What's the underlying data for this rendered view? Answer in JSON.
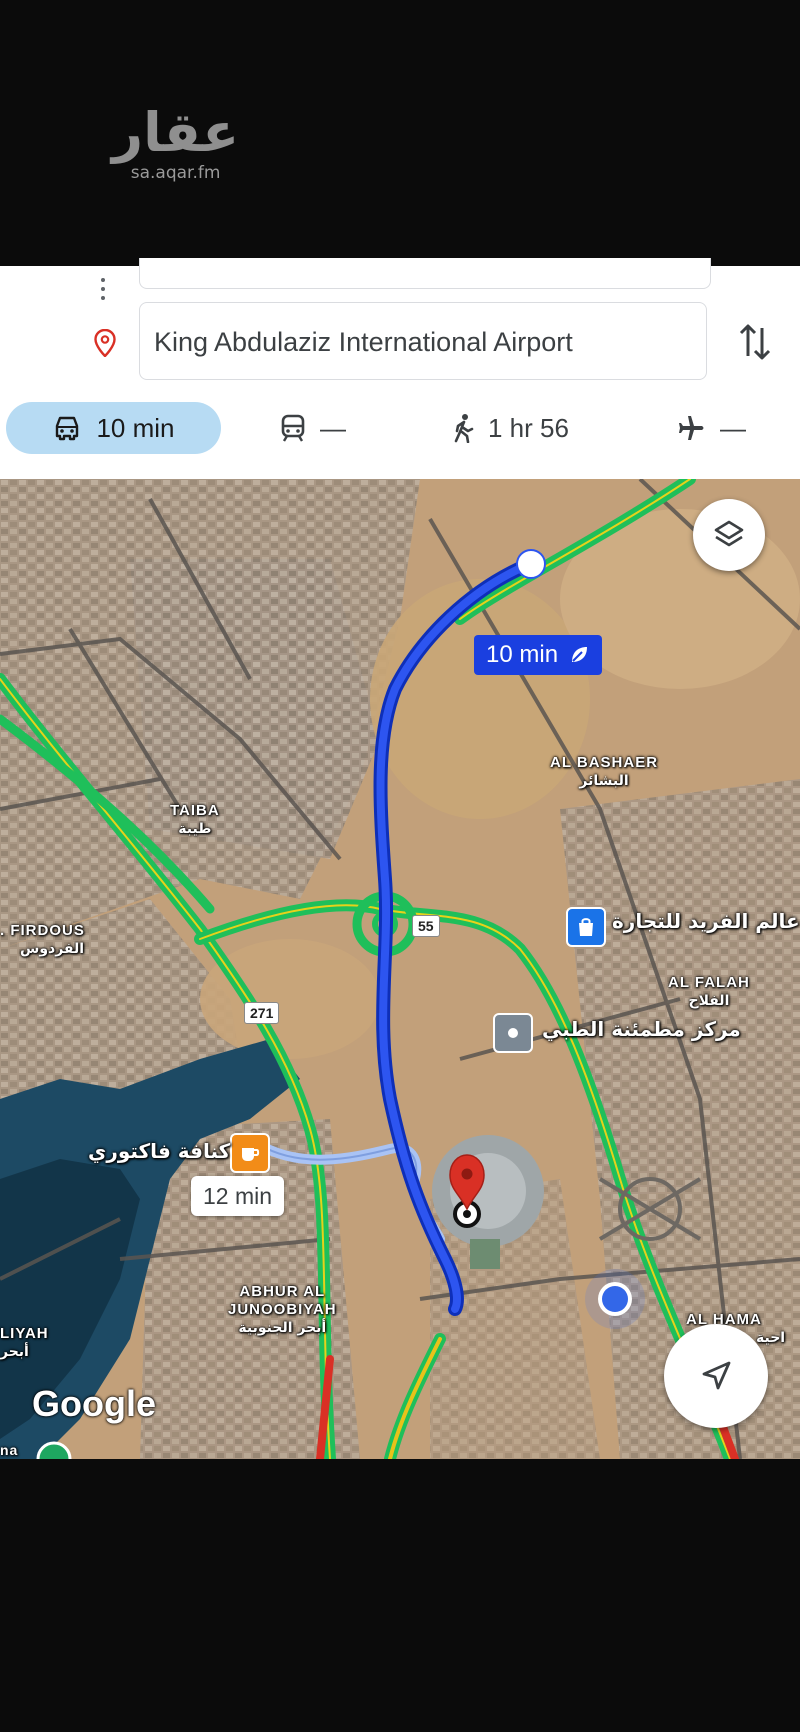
{
  "watermark": {
    "brand": "عقار",
    "url": "sa.aqar.fm"
  },
  "directions": {
    "destination": "King Abdulaziz International Airport",
    "modes": [
      {
        "name": "drive",
        "icon": "car-icon",
        "label": "10 min",
        "selected": true
      },
      {
        "name": "transit",
        "icon": "train-icon",
        "label": "—"
      },
      {
        "name": "walk",
        "icon": "walk-icon",
        "label": "1 hr 56"
      },
      {
        "name": "flight",
        "icon": "plane-icon",
        "label": "—"
      }
    ]
  },
  "map": {
    "route_badge": "10 min",
    "alt_route_badge": "12 min",
    "labels": {
      "al_bashaer_en": "AL BASHAER",
      "al_bashaer_ar": "البشائر",
      "taiba_en": "TAIBA",
      "taiba_ar": "طيبة",
      "firdous_en": ". FIRDOUS",
      "firdous_ar": "الفردوس",
      "al_falah_en": "AL FALAH",
      "al_falah_ar": "الفلاح",
      "abhur_en_1": "ABHUR AL",
      "abhur_en_2": "JUNOOBIYAH",
      "abhur_ar": "أبحر الجنوبية",
      "al_hama_en": "AL HAMA",
      "al_hama_ar": "احية",
      "liyah_en": "LIYAH",
      "liyah_ar": "أبحر",
      "bottom_left": "na"
    },
    "pois": {
      "shop": "عالم الفريد للتجارة",
      "medical": "مركز مطمئنة الطبي",
      "cafe": "كنافة فاكتوري"
    },
    "shields": {
      "road_55": "55",
      "road_271": "271"
    },
    "attribution": "Google",
    "colors": {
      "route": "#1a3fe0",
      "alt_route": "#a9c3f5",
      "traffic_green": "#1fbf5a",
      "traffic_red": "#d93025"
    }
  }
}
